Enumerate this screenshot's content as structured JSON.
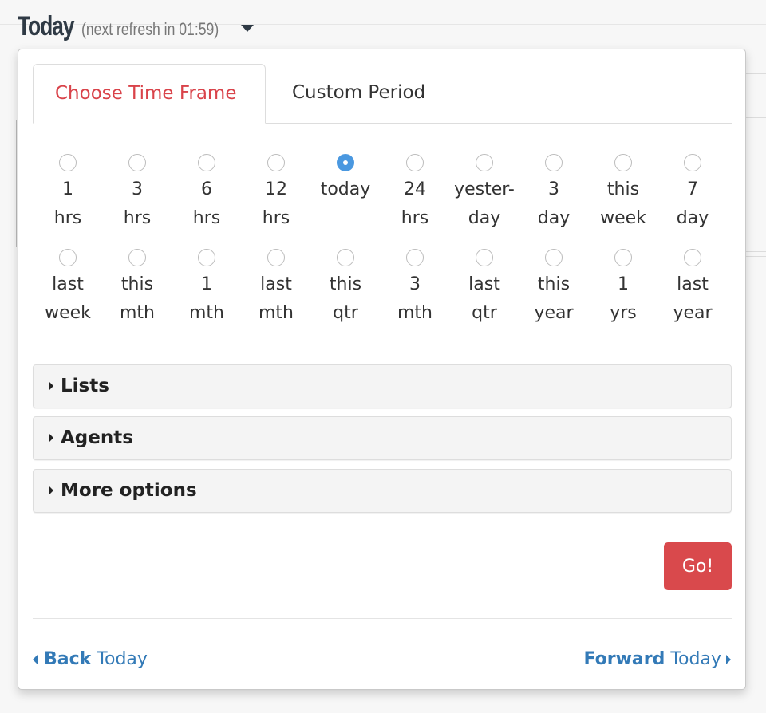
{
  "header": {
    "title": "Today",
    "refresh_text": "(next refresh in 01:59)"
  },
  "tabs": [
    {
      "label": "Choose Time Frame",
      "active": true
    },
    {
      "label": "Custom Period",
      "active": false
    }
  ],
  "time_frames": {
    "selected": "today",
    "row1": [
      {
        "id": "1h",
        "line1": "1",
        "line2": "hrs"
      },
      {
        "id": "3h",
        "line1": "3",
        "line2": "hrs"
      },
      {
        "id": "6h",
        "line1": "6",
        "line2": "hrs"
      },
      {
        "id": "12h",
        "line1": "12",
        "line2": "hrs"
      },
      {
        "id": "today",
        "line1": "today",
        "line2": ""
      },
      {
        "id": "24h",
        "line1": "24",
        "line2": "hrs"
      },
      {
        "id": "yesterday",
        "line1": "yester-",
        "line2": "day"
      },
      {
        "id": "3d",
        "line1": "3",
        "line2": "day"
      },
      {
        "id": "thisweek",
        "line1": "this",
        "line2": "week"
      },
      {
        "id": "7d",
        "line1": "7",
        "line2": "day"
      }
    ],
    "row2": [
      {
        "id": "lastweek",
        "line1": "last",
        "line2": "week"
      },
      {
        "id": "thismth",
        "line1": "this",
        "line2": "mth"
      },
      {
        "id": "1mth",
        "line1": "1",
        "line2": "mth"
      },
      {
        "id": "lastmth",
        "line1": "last",
        "line2": "mth"
      },
      {
        "id": "thisqtr",
        "line1": "this",
        "line2": "qtr"
      },
      {
        "id": "3mth",
        "line1": "3",
        "line2": "mth"
      },
      {
        "id": "lastqtr",
        "line1": "last",
        "line2": "qtr"
      },
      {
        "id": "thisyear",
        "line1": "this",
        "line2": "year"
      },
      {
        "id": "1yrs",
        "line1": "1",
        "line2": "yrs"
      },
      {
        "id": "lastyear",
        "line1": "last",
        "line2": "year"
      }
    ]
  },
  "accordions": [
    {
      "label": "Lists"
    },
    {
      "label": "Agents"
    },
    {
      "label": "More options"
    }
  ],
  "go_button": "Go!",
  "nav": {
    "back_bold": "Back",
    "back_rest": "Today",
    "forward_bold": "Forward",
    "forward_rest": "Today"
  },
  "colors": {
    "accent_red": "#d9434a",
    "radio_selected": "#4a98e0",
    "link_blue": "#337ab7"
  }
}
